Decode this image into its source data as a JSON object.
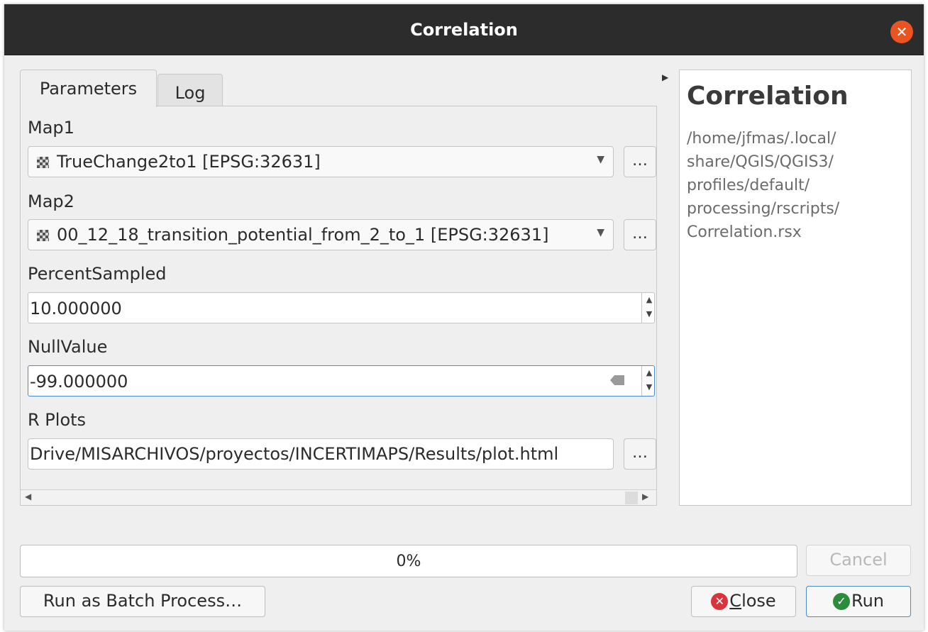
{
  "window": {
    "title": "Correlation",
    "close_glyph": "✕"
  },
  "tabs": [
    {
      "label": "Parameters",
      "active": true
    },
    {
      "label": "Log",
      "active": false
    }
  ],
  "params": {
    "map1": {
      "label": "Map1",
      "value": "TrueChange2to1 [EPSG:32631]",
      "more": "…"
    },
    "map2": {
      "label": "Map2",
      "value": "00_12_18_transition_potential_from_2_to_1 [EPSG:32631]",
      "more": "…"
    },
    "percent_sampled": {
      "label": "PercentSampled",
      "value": "10.000000"
    },
    "null_value": {
      "label": "NullValue",
      "value": "-99.000000"
    },
    "r_plots": {
      "label": "R Plots",
      "value": "Drive/MISARCHIVOS/proyectos/INCERTIMAPS/Results/plot.html",
      "more": "…"
    }
  },
  "help": {
    "title": "Correlation",
    "path": "/home/jfmas/.local/\nshare/QGIS/QGIS3/\nprofiles/default/\nprocessing/rscripts/\nCorrelation.rsx"
  },
  "progress": {
    "text": "0%",
    "value": 0
  },
  "buttons": {
    "cancel": "Cancel",
    "batch": "Run as Batch Process…",
    "close_first": "C",
    "close_rest": "lose",
    "run": "Run"
  },
  "colors": {
    "accent": "#4a8ad4",
    "close_icon": "#d9343b",
    "run_icon": "#2c8c3c",
    "titlebar": "#2c2c2c",
    "window_close": "#e95420"
  }
}
